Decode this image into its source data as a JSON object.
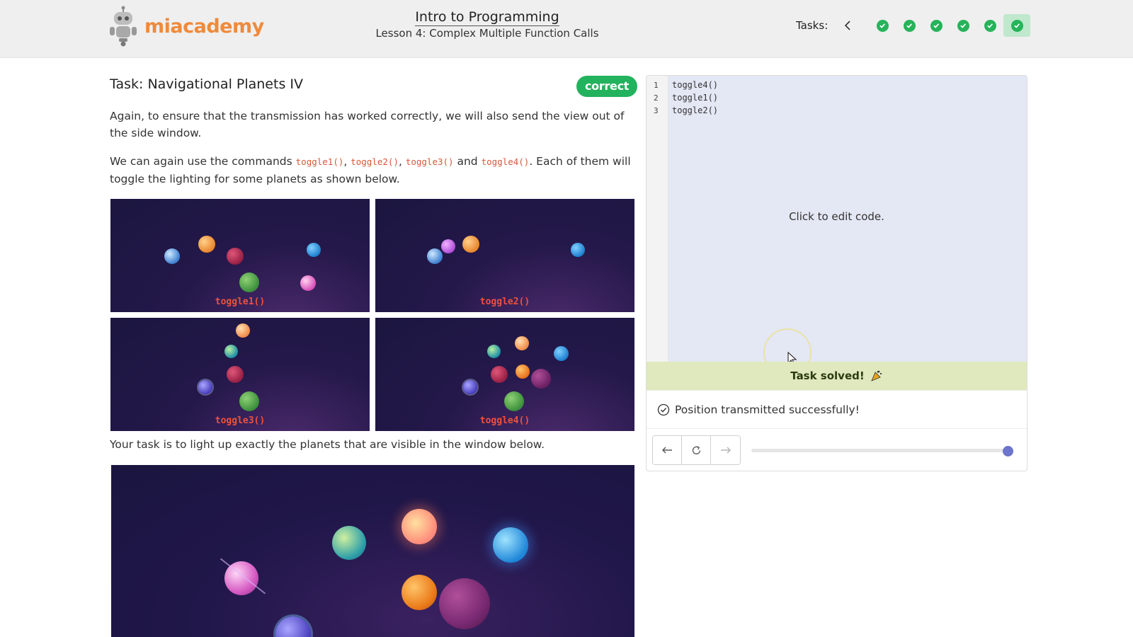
{
  "header": {
    "logo_text": "miacademy",
    "course_title": "Intro to Programming",
    "lesson_title": "Lesson 4: Complex Multiple Function Calls",
    "tasks_label": "Tasks:",
    "tasks": [
      {
        "status": "complete",
        "active": false
      },
      {
        "status": "complete",
        "active": false
      },
      {
        "status": "complete",
        "active": false
      },
      {
        "status": "complete",
        "active": false
      },
      {
        "status": "complete",
        "active": false
      },
      {
        "status": "complete",
        "active": true
      }
    ]
  },
  "task": {
    "title": "Task: Navigational Planets IV",
    "badge": "correct",
    "para1": "Again, to ensure that the transmission has worked correctly, we will also send the view out of the side window.",
    "para2": {
      "prefix": "We can again use the commands ",
      "cmd1": "toggle1()",
      "sep1": ", ",
      "cmd2": "toggle2()",
      "sep2": ", ",
      "cmd3": "toggle3()",
      "and": " and ",
      "cmd4": "toggle4()",
      "suffix": ". Each of them will toggle the lighting for some planets as shown below."
    },
    "panels": [
      {
        "label": "toggle1()"
      },
      {
        "label": "toggle2()"
      },
      {
        "label": "toggle3()"
      },
      {
        "label": "toggle4()"
      }
    ],
    "para3": "Your task is to light up exactly the planets that are visible in the window below."
  },
  "editor": {
    "lines": [
      {
        "num": "1",
        "code": "toggle4()"
      },
      {
        "num": "2",
        "code": "toggle1()"
      },
      {
        "num": "3",
        "code": "toggle2()"
      }
    ],
    "hint": "Click to edit code.",
    "solved": "Task solved!",
    "message": "Position transmitted successfully!",
    "step_progress": 1.0
  },
  "colors": {
    "accent_green": "#23b25d",
    "brand_orange": "#ef8a3b",
    "code_red": "#d5573b",
    "slider_thumb": "#6c74cc"
  }
}
